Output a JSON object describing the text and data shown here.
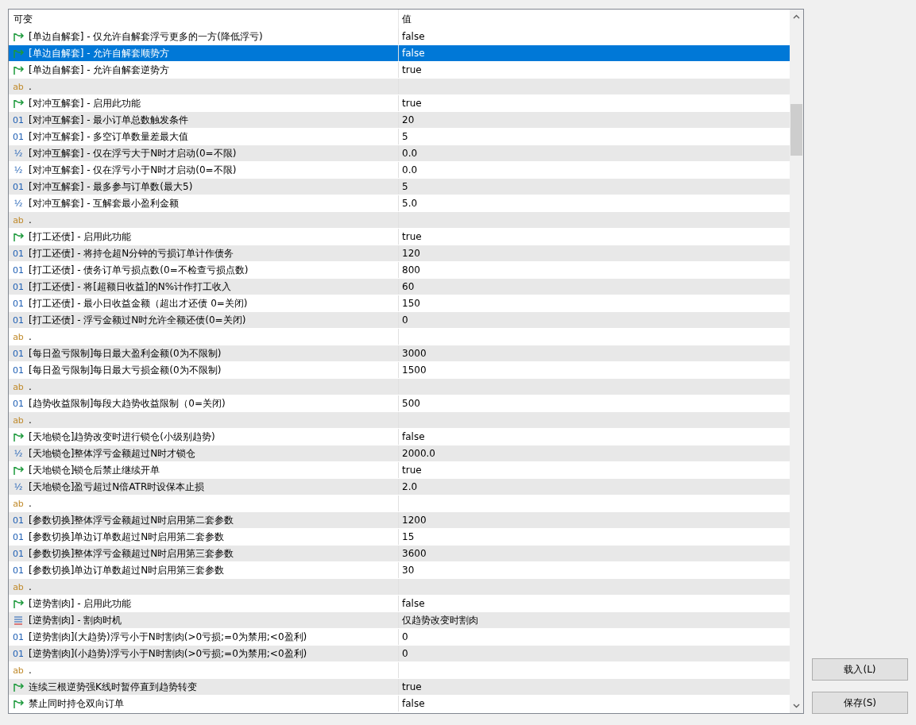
{
  "table": {
    "columns": [
      "可变",
      "值"
    ],
    "rows": [
      {
        "kind": "bool",
        "name": "[单边自解套] - 仅允许自解套浮亏更多的一方(降低浮亏)",
        "value": "false",
        "selected": false
      },
      {
        "kind": "bool",
        "name": "[单边自解套] - 允许自解套顺势方",
        "value": "false",
        "selected": true
      },
      {
        "kind": "bool",
        "name": "[单边自解套] - 允许自解套逆势方",
        "value": "true",
        "selected": false
      },
      {
        "kind": "string",
        "glyph": "ab",
        "name": ".",
        "selected": false
      },
      {
        "kind": "bool",
        "name": "[对冲互解套] - 启用此功能",
        "value": "true",
        "selected": false
      },
      {
        "kind": "int",
        "glyph": "01",
        "name": "[对冲互解套] - 最小订单总数触发条件",
        "value": "20",
        "selected": false
      },
      {
        "kind": "int",
        "glyph": "01",
        "name": "[对冲互解套] - 多空订单数量差最大值",
        "value": "5",
        "selected": false
      },
      {
        "kind": "double",
        "glyph": "½",
        "name": "[对冲互解套] - 仅在浮亏大于N时才启动(0=不限)",
        "value": "0.0",
        "selected": false
      },
      {
        "kind": "double",
        "glyph": "½",
        "name": "[对冲互解套] - 仅在浮亏小于N时才启动(0=不限)",
        "value": "0.0",
        "selected": false
      },
      {
        "kind": "int",
        "glyph": "01",
        "name": "[对冲互解套] - 最多参与订单数(最大5)",
        "value": "5",
        "selected": false
      },
      {
        "kind": "double",
        "glyph": "½",
        "name": "[对冲互解套] - 互解套最小盈利金额",
        "value": "5.0",
        "selected": false
      },
      {
        "kind": "string",
        "glyph": "ab",
        "name": ".",
        "selected": false
      },
      {
        "kind": "bool",
        "name": "[打工还债] - 启用此功能",
        "value": "true",
        "selected": false
      },
      {
        "kind": "int",
        "glyph": "01",
        "name": "[打工还债] - 将持仓超N分钟的亏损订单计作债务",
        "value": "120",
        "selected": false
      },
      {
        "kind": "int",
        "glyph": "01",
        "name": "[打工还债] - 债务订单亏损点数(0=不检查亏损点数)",
        "value": "800",
        "selected": false
      },
      {
        "kind": "int",
        "glyph": "01",
        "name": "[打工还债] - 将[超额日收益]的N%计作打工收入",
        "value": "60",
        "selected": false
      },
      {
        "kind": "int",
        "glyph": "01",
        "name": "[打工还债] - 最小日收益金额（超出才还债 0=关闭)",
        "value": "150",
        "selected": false
      },
      {
        "kind": "int",
        "glyph": "01",
        "name": "[打工还债] - 浮亏金额过N时允许全额还债(0=关闭)",
        "value": "0",
        "selected": false
      },
      {
        "kind": "string",
        "glyph": "ab",
        "name": ".",
        "selected": false
      },
      {
        "kind": "int",
        "glyph": "01",
        "name": "[每日盈亏限制]每日最大盈利金额(0为不限制)",
        "value": "3000",
        "selected": false
      },
      {
        "kind": "int",
        "glyph": "01",
        "name": "[每日盈亏限制]每日最大亏损金额(0为不限制)",
        "value": "1500",
        "selected": false
      },
      {
        "kind": "string",
        "glyph": "ab",
        "name": ".",
        "selected": false
      },
      {
        "kind": "int",
        "glyph": "01",
        "name": "[趋势收益限制]每段大趋势收益限制（0=关闭)",
        "value": "500",
        "selected": false
      },
      {
        "kind": "string",
        "glyph": "ab",
        "name": ".",
        "selected": false
      },
      {
        "kind": "bool",
        "name": "[天地锁仓]趋势改变时进行锁仓(小级别趋势)",
        "value": "false",
        "selected": false
      },
      {
        "kind": "double",
        "glyph": "½",
        "name": "[天地锁仓]整体浮亏金额超过N时才锁仓",
        "value": "2000.0",
        "selected": false
      },
      {
        "kind": "bool",
        "name": "[天地锁仓]锁仓后禁止继续开单",
        "value": "true",
        "selected": false
      },
      {
        "kind": "double",
        "glyph": "½",
        "name": "[天地锁仓]盈亏超过N倍ATR时设保本止损",
        "value": "2.0",
        "selected": false
      },
      {
        "kind": "string",
        "glyph": "ab",
        "name": ".",
        "selected": false
      },
      {
        "kind": "int",
        "glyph": "01",
        "name": "[参数切换]整体浮亏金额超过N时启用第二套参数",
        "value": "1200",
        "selected": false
      },
      {
        "kind": "int",
        "glyph": "01",
        "name": "[参数切换]单边订单数超过N时启用第二套参数",
        "value": "15",
        "selected": false
      },
      {
        "kind": "int",
        "glyph": "01",
        "name": "[参数切换]整体浮亏金额超过N时启用第三套参数",
        "value": "3600",
        "selected": false
      },
      {
        "kind": "int",
        "glyph": "01",
        "name": "[参数切换]单边订单数超过N时启用第三套参数",
        "value": "30",
        "selected": false
      },
      {
        "kind": "string",
        "glyph": "ab",
        "name": ".",
        "selected": false
      },
      {
        "kind": "bool",
        "name": "[逆势割肉] - 启用此功能",
        "value": "false",
        "selected": false
      },
      {
        "kind": "enum",
        "name": "[逆势割肉] - 割肉时机",
        "value": "仅趋势改变时割肉",
        "selected": false
      },
      {
        "kind": "int",
        "glyph": "01",
        "name": "[逆势割肉](大趋势)浮亏小于N时割肉(>0亏损;=0为禁用;<0盈利)",
        "value": "0",
        "selected": false
      },
      {
        "kind": "int",
        "glyph": "01",
        "name": "[逆势割肉](小趋势)浮亏小于N时割肉(>0亏损;=0为禁用;<0盈利)",
        "value": "0",
        "selected": false
      },
      {
        "kind": "string",
        "glyph": "ab",
        "name": ".",
        "selected": false
      },
      {
        "kind": "bool",
        "name": "连续三根逆势强K线时暂停直到趋势转变",
        "value": "true",
        "selected": false
      },
      {
        "kind": "bool",
        "name": "禁止同时持仓双向订单",
        "value": "false",
        "selected": false
      }
    ]
  },
  "buttons": [
    "载入(L)",
    "保存(S)"
  ]
}
